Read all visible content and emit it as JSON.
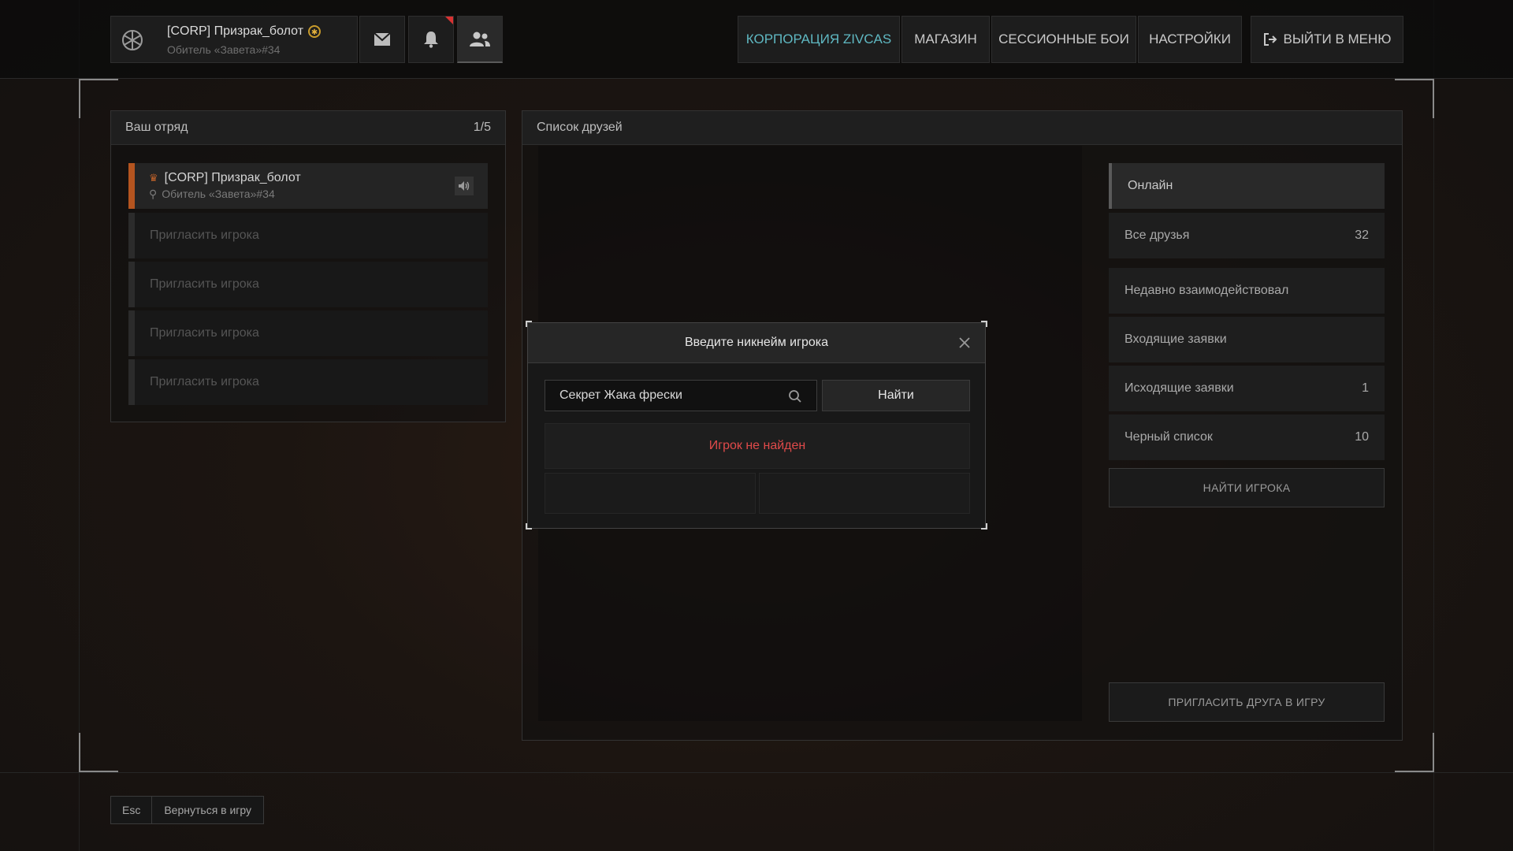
{
  "profile": {
    "name": "[CORP] Призрак_болот",
    "tag": "Обитель «Завета»#34",
    "badge": "✱"
  },
  "nav": {
    "corp": "КОРПОРАЦИЯ ZIVCAS",
    "shop": "МАГАЗИН",
    "sessions": "СЕССИОННЫЕ БОИ",
    "settings": "НАСТРОЙКИ",
    "exit": "ВЫЙТИ В МЕНЮ"
  },
  "squad": {
    "title": "Ваш отряд",
    "count": "1/5",
    "leader_name": "[CORP] Призрак_болот",
    "leader_location": "Обитель «Завета»#34",
    "invite_label": "Пригласить игрока"
  },
  "friends": {
    "title": "Список друзей",
    "categories": [
      {
        "label": "Онлайн",
        "count": ""
      },
      {
        "label": "Все друзья",
        "count": "32"
      },
      {
        "label": "Недавно взаимодействовал",
        "count": ""
      },
      {
        "label": "Входящие заявки",
        "count": ""
      },
      {
        "label": "Исходящие заявки",
        "count": "1"
      },
      {
        "label": "Черный список",
        "count": "10"
      }
    ],
    "find_player": "НАЙТИ ИГРОКА",
    "invite_friend": "ПРИГЛАСИТЬ ДРУГА В ИГРУ"
  },
  "modal": {
    "title": "Введите никнейм игрока",
    "search_value": "Секрет Жака фрески",
    "find_button": "Найти",
    "result": "Игрок не найден"
  },
  "footer": {
    "key": "Esc",
    "label": "Вернуться в игру"
  },
  "colors": {
    "accent_teal": "#5fb8c2",
    "leader_orange": "#b4541f",
    "error_red": "#e04a4a",
    "notification_red": "#d83232"
  }
}
